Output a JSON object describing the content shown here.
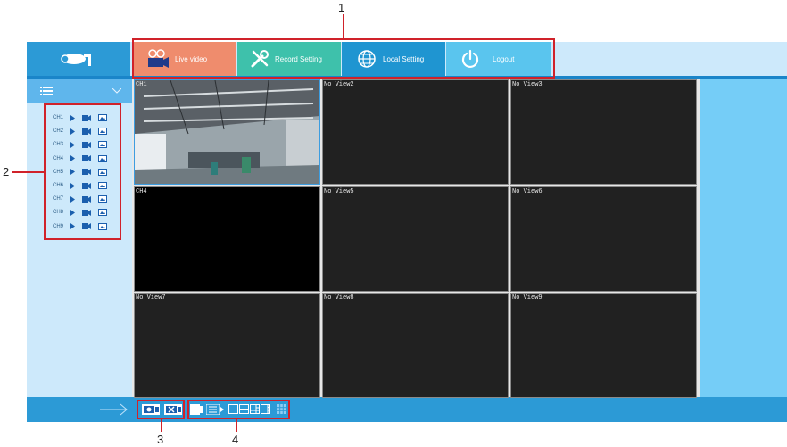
{
  "nav": {
    "live_label": "Live video",
    "record_label": "Record Setting",
    "local_label": "Local Setting",
    "logout_label": "Logout"
  },
  "sidebar": {
    "channels": [
      "CH1",
      "CH2",
      "CH3",
      "CH4",
      "CH5",
      "CH6",
      "CH7",
      "CH8",
      "CH9"
    ]
  },
  "grid": {
    "cells": [
      "CH1",
      "No View2",
      "No View3",
      "CH4",
      "No View5",
      "No View6",
      "No View7",
      "No View8",
      "No View9"
    ]
  },
  "callouts": [
    "1",
    "2",
    "3",
    "4"
  ],
  "colors": {
    "accent": "#2c9ad6",
    "live_tab": "#ef8c6d",
    "record_tab": "#3ec1ab",
    "local_tab": "#1f95d1",
    "logout_tab": "#5ac5ee",
    "annotation": "#d0222a"
  },
  "icons": [
    "camera-logo-icon",
    "live-video-icon",
    "record-setting-icon",
    "local-setting-icon",
    "logout-icon",
    "list-icon",
    "chevron-down-icon",
    "play-icon",
    "record-icon",
    "snapshot-icon",
    "arrow-right-icon"
  ]
}
